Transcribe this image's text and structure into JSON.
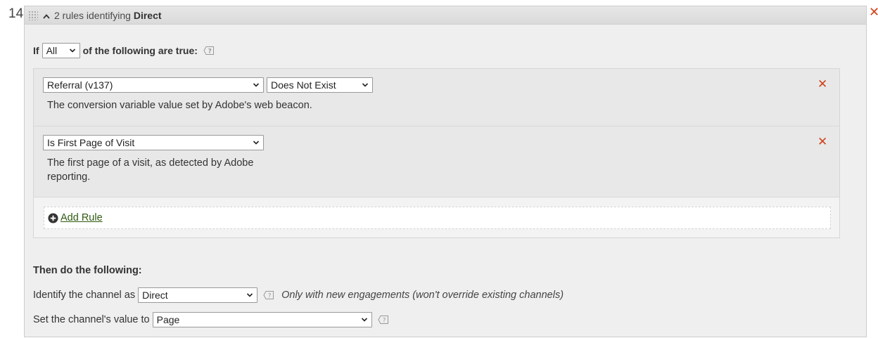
{
  "rule_number": "14",
  "header": {
    "prefix": "2 rules identifying ",
    "channel_name": "Direct"
  },
  "condition": {
    "if_label": "If",
    "match_selected": "All",
    "suffix": "of the following are true:"
  },
  "rules": [
    {
      "variable": "Referral (v137)",
      "operator": "Does Not Exist",
      "description": "The conversion variable value set by Adobe's web beacon."
    },
    {
      "variable": "Is First Page of Visit",
      "description": "The first page of a visit, as detected by Adobe reporting."
    }
  ],
  "add_rule_label": "Add Rule",
  "then": {
    "title": "Then do the following:",
    "identify_label": "Identify the channel as",
    "identify_value": "Direct",
    "identify_note": "Only with new engagements (won't override existing channels)",
    "set_value_label": "Set the channel's value to",
    "set_value_selected": "Page"
  },
  "colors": {
    "remove_icon": "#d0421b",
    "link": "#2f5b10",
    "panel_bg": "#efefef"
  },
  "icons": {
    "drag": "drag-handle-icon",
    "collapse": "chevron-up-icon",
    "help": "help-icon",
    "remove": "close-icon",
    "add": "plus-circle-icon"
  }
}
